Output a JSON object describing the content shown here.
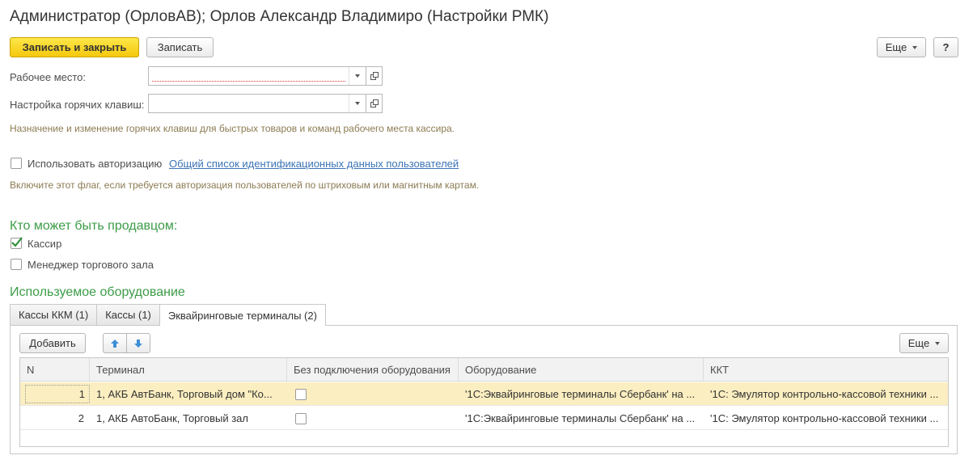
{
  "window": {
    "title": "Администратор (ОрловАВ); Орлов Александр Владимиро (Настройки РМК)"
  },
  "toolbar": {
    "save_close_label": "Записать и закрыть",
    "save_label": "Записать",
    "more_label": "Еще",
    "help_label": "?"
  },
  "form": {
    "workplace_label": "Рабочее место:",
    "workplace_value": "",
    "hotkeys_label": "Настройка горячих клавиш:",
    "hotkeys_value": "",
    "hotkeys_hint": "Назначение и изменение горячих клавиш для быстрых товаров и команд рабочего места кассира.",
    "use_auth_label": "Использовать авторизацию",
    "use_auth_checked": false,
    "auth_link": "Общий список идентификационных данных пользователей",
    "auth_hint": "Включите этот флаг, если требуется авторизация пользователей по штриховым или магнитным картам."
  },
  "sellers": {
    "title": "Кто может быть продавцом:",
    "cashier_label": "Кассир",
    "cashier_checked": true,
    "manager_label": "Менеджер торгового зала",
    "manager_checked": false
  },
  "equipment": {
    "title": "Используемое оборудование",
    "tabs": [
      {
        "label": "Кассы ККМ (1)",
        "active": false
      },
      {
        "label": "Кассы (1)",
        "active": false
      },
      {
        "label": "Эквайринговые терминалы (2)",
        "active": true
      }
    ],
    "add_label": "Добавить",
    "more_label": "Еще",
    "columns": [
      "N",
      "Терминал",
      "Без подключения оборудования",
      "Оборудование",
      "ККТ"
    ],
    "rows": [
      {
        "n": "1",
        "terminal": "1, АКБ АвтБанк, Торговый дом \"Ко...",
        "no_connection": false,
        "equipment": "'1С:Эквайринговые терминалы Сбербанк' на ...",
        "kkt": "'1С: Эмулятор контрольно-кассовой техники ...",
        "selected": true
      },
      {
        "n": "2",
        "terminal": "1, АКБ АвтоБанк, Торговый зал",
        "no_connection": false,
        "equipment": "'1С:Эквайринговые терминалы Сбербанк' на ...",
        "kkt": "'1С: Эмулятор контрольно-кассовой техники ...",
        "selected": false
      }
    ]
  },
  "colors": {
    "accent_yellow": "#f5c80c",
    "section_green": "#3c9c48",
    "hint_brown": "#8c7b52",
    "link_blue": "#3c74b4",
    "selected_row": "#fbeec0"
  }
}
